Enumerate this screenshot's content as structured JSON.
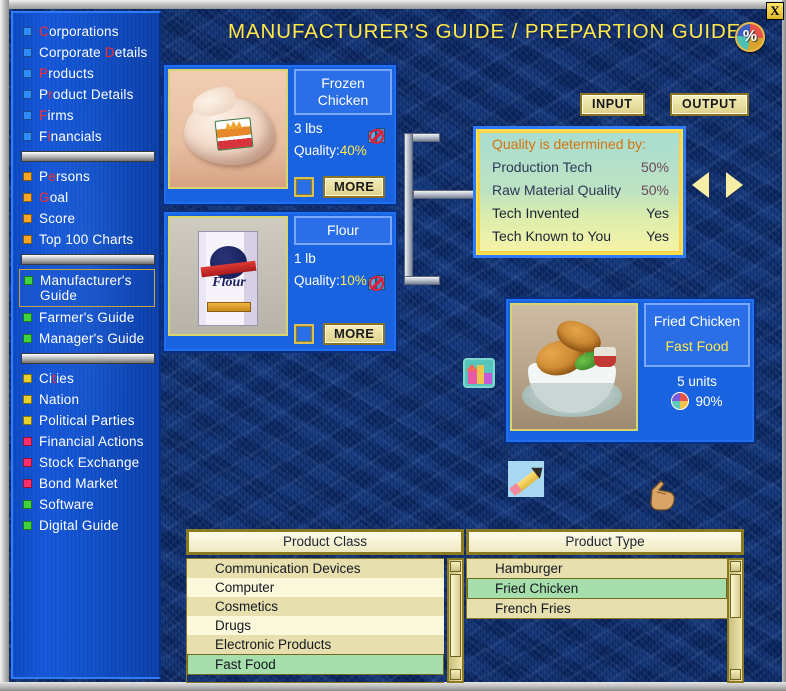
{
  "window": {
    "close_label": "X",
    "percent_icon_label": "%",
    "percent_icon_name": "pie-percent-icon"
  },
  "header": {
    "title": "MANUFACTURER'S GUIDE / PREPARTION GUIDE"
  },
  "sidebar": {
    "groups": [
      {
        "color": "#2f8cff",
        "items": [
          "Corporations",
          "Corporate Details",
          "Products",
          "Product Details",
          "Firms",
          "Financials"
        ]
      },
      {
        "color": "#f5a623",
        "items": [
          "Persons",
          "Goal",
          "Score",
          "Top 100 Charts"
        ]
      },
      {
        "color": "#3fd23f",
        "items": [
          "Manufacturer's Guide",
          "Farmer's Guide",
          "Manager's Guide"
        ]
      },
      {
        "color": "#e8d22a",
        "items": [
          "Cities",
          "Nation",
          "Political Parties"
        ]
      },
      {
        "color": "#ff2b6b",
        "items": [
          "Financial Actions",
          "Stock Exchange",
          "Bond Market"
        ]
      },
      {
        "color": "#3fd23f",
        "items": [
          "Software",
          "Digital Guide"
        ]
      }
    ],
    "selected": "Manufacturer's Guide"
  },
  "inputs": [
    {
      "name": "Frozen Chicken",
      "amount": "3 lbs",
      "quality_label": "Quality:",
      "quality_value": "40%",
      "more_label": "MORE",
      "art": "frozen-chicken",
      "not_produced_icon": "no-factory-icon"
    },
    {
      "name": "Flour",
      "amount": "1 lb",
      "quality_label": "Quality:",
      "quality_value": "10%",
      "more_label": "MORE",
      "art": "flour",
      "not_produced_icon": "no-factory-icon"
    }
  ],
  "quality_panel": {
    "heading": "Quality is determined by:",
    "rows": [
      {
        "key": "Production Tech",
        "value": "50%"
      },
      {
        "key": "Raw Material Quality",
        "value": "50%"
      },
      {
        "key": "Tech Invented",
        "value": "Yes"
      },
      {
        "key": "Tech Known to You",
        "value": "Yes"
      }
    ]
  },
  "io_buttons": {
    "input": "INPUT",
    "output": "OUTPUT"
  },
  "nav": {
    "prev_icon": "arrow-left-icon",
    "next_icon": "arrow-right-icon"
  },
  "output": {
    "name": "Fried Chicken",
    "class": "Fast Food",
    "units": "5 units",
    "quality_value": "90%",
    "art": "fried-chicken"
  },
  "product_class": {
    "title": "Product Class",
    "items": [
      "Communication Devices",
      "Computer",
      "Cosmetics",
      "Drugs",
      "Electronic Products",
      "Fast Food"
    ],
    "selected": "Fast Food"
  },
  "product_type": {
    "title": "Product Type",
    "items": [
      "Hamburger",
      "Fried Chicken",
      "French Fries"
    ],
    "selected": "Fried Chicken"
  },
  "icons": {
    "factory": "factory-building-icon",
    "pencil": "pencil-edit-icon",
    "cursor": "hand-pointer-cursor"
  }
}
